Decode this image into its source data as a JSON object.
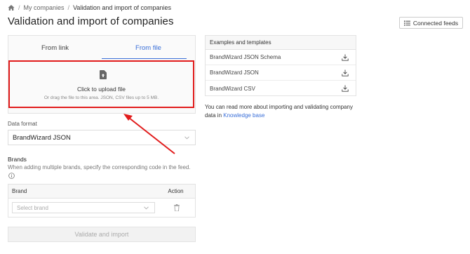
{
  "breadcrumb": {
    "items": [
      "My companies",
      "Validation and import of companies"
    ],
    "separator": "/"
  },
  "page": {
    "title": "Validation and import of companies"
  },
  "header": {
    "connected_feeds_label": "Connected feeds"
  },
  "import_panel": {
    "tabs": [
      {
        "label": "From link",
        "active": false
      },
      {
        "label": "From file",
        "active": true
      }
    ],
    "upload": {
      "title": "Click to upload file",
      "hint": "Or drag the file to this area. JSON, CSV files up to 5 MB."
    }
  },
  "data_format": {
    "label": "Data format",
    "selected": "BrandWizard JSON"
  },
  "brands": {
    "title": "Brands",
    "description": "When adding multiple brands, specify the corresponding code in the feed.",
    "table": {
      "columns": [
        "Brand",
        "Action"
      ],
      "rows": [
        {
          "brand_placeholder": "Select brand"
        }
      ]
    }
  },
  "actions": {
    "validate_label": "Validate and import"
  },
  "examples": {
    "title": "Examples and templates",
    "items": [
      {
        "label": "BrandWizard JSON Schema"
      },
      {
        "label": "BrandWizard JSON"
      },
      {
        "label": "BrandWizard CSV"
      }
    ]
  },
  "info_text": {
    "before_link": "You can read more about importing and validating company data in ",
    "link": "Knowledge base"
  },
  "colors": {
    "accent": "#3a6fd8",
    "highlight": "#e11b1b"
  }
}
